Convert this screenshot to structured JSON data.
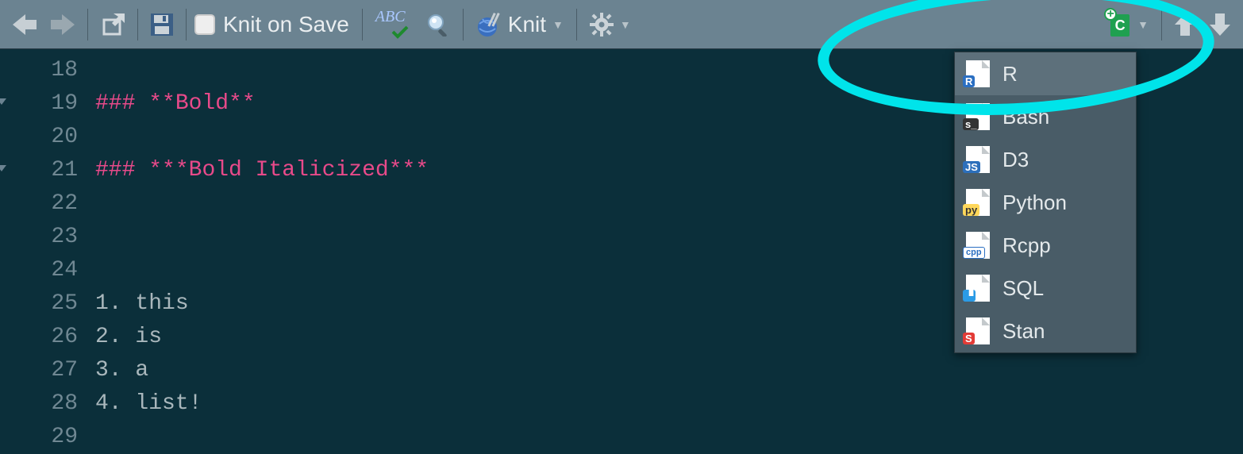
{
  "toolbar": {
    "knit_on_save": "Knit on Save",
    "knit": "Knit",
    "abc": "ABC"
  },
  "gutter": [
    "18",
    "19",
    "20",
    "21",
    "22",
    "23",
    "24",
    "25",
    "26",
    "27",
    "28",
    "29"
  ],
  "code": {
    "l19_hash": "### ",
    "l19_star1": "**",
    "l19_text": "Bold",
    "l19_star2": "**",
    "l21_hash": "### ",
    "l21_star1": "***",
    "l21_text": "Bold Italicized",
    "l21_star2": "***",
    "l25": "1. this",
    "l26": "2. is",
    "l27": "3. a",
    "l28": "4. list!"
  },
  "insert_button": "C",
  "chunk_menu": {
    "r": "R",
    "bash": "Bash",
    "d3": "D3",
    "python": "Python",
    "rcpp": "Rcpp",
    "sql": "SQL",
    "stan": "Stan"
  }
}
